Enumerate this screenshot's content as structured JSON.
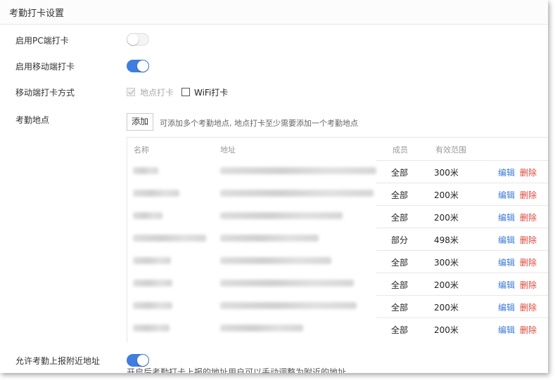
{
  "header": {
    "title": "考勤打卡设置"
  },
  "settings": {
    "pc_clock": {
      "label": "启用PC端打卡",
      "enabled": false
    },
    "mobile_clock": {
      "label": "启用移动端打卡",
      "enabled": true
    },
    "mobile_method": {
      "label": "移动端打卡方式",
      "location_option": {
        "label": "地点打卡",
        "checked": true,
        "disabled": true
      },
      "wifi_option": {
        "label": "WiFi打卡",
        "checked": false
      }
    },
    "locations": {
      "label": "考勤地点",
      "add_button": "添加",
      "hint": "可添加多个考勤地点, 地点打卡至少需要添加一个考勤地点"
    },
    "nearby": {
      "label": "允许考勤上报附近地址",
      "enabled": true,
      "description": "开启后考勤打卡上报的地址用户可以手动调整为附近的地址"
    }
  },
  "table": {
    "columns": [
      "名称",
      "地址",
      "成员",
      "有效范围"
    ],
    "edit_label": "编辑",
    "delete_label": "删除",
    "rows": [
      {
        "members": "全部",
        "range": "300米"
      },
      {
        "members": "全部",
        "range": "200米"
      },
      {
        "members": "全部",
        "range": "200米"
      },
      {
        "members": "部分",
        "range": "498米"
      },
      {
        "members": "全部",
        "range": "300米"
      },
      {
        "members": "全部",
        "range": "200米"
      },
      {
        "members": "全部",
        "range": "200米"
      },
      {
        "members": "全部",
        "range": "200米"
      }
    ]
  },
  "colors": {
    "switch_on": "#3f7de0",
    "edit_link": "#3a7bd5",
    "delete_link": "#e0463a"
  }
}
